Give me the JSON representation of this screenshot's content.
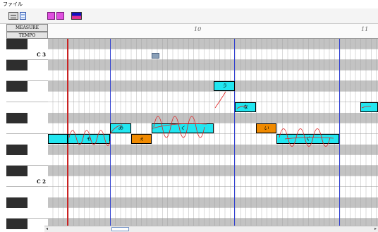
{
  "menu": {
    "file_label": "ファイル"
  },
  "toolbar": {
    "buttons": [
      "piano-roll-view-button",
      "list-view-button",
      "note-tool-1-button",
      "note-tool-2-button",
      "color-tool-button"
    ]
  },
  "header": {
    "measure_label": "MEASURE",
    "tempo_label": "TEMPO"
  },
  "ruler": {
    "marks": [
      "10",
      "11"
    ]
  },
  "keyboard": {
    "c3_label": "C 3",
    "c2_label": "C 2"
  },
  "notes": [
    {
      "lyric": "",
      "kind": "note"
    },
    {
      "lyric": "も",
      "kind": "note"
    },
    {
      "lyric": "め",
      "kind": "note"
    },
    {
      "lyric": "ぇ",
      "kind": "rest"
    },
    {
      "lyric": "く",
      "kind": "note"
    },
    {
      "lyric": "う",
      "kind": "note"
    },
    {
      "lyric": "な",
      "kind": "note"
    },
    {
      "lyric": "い",
      "kind": "rest"
    },
    {
      "lyric": "く",
      "kind": "note"
    },
    {
      "lyric": "",
      "kind": "note"
    },
    {
      "lyric": "",
      "kind": "small"
    }
  ],
  "colors": {
    "note_fill": "#22e6f0",
    "rest_fill": "#f08a00",
    "vibrato_line": "#e02020",
    "playhead": "#cc2222",
    "measure_line": "#2f3fd0"
  }
}
